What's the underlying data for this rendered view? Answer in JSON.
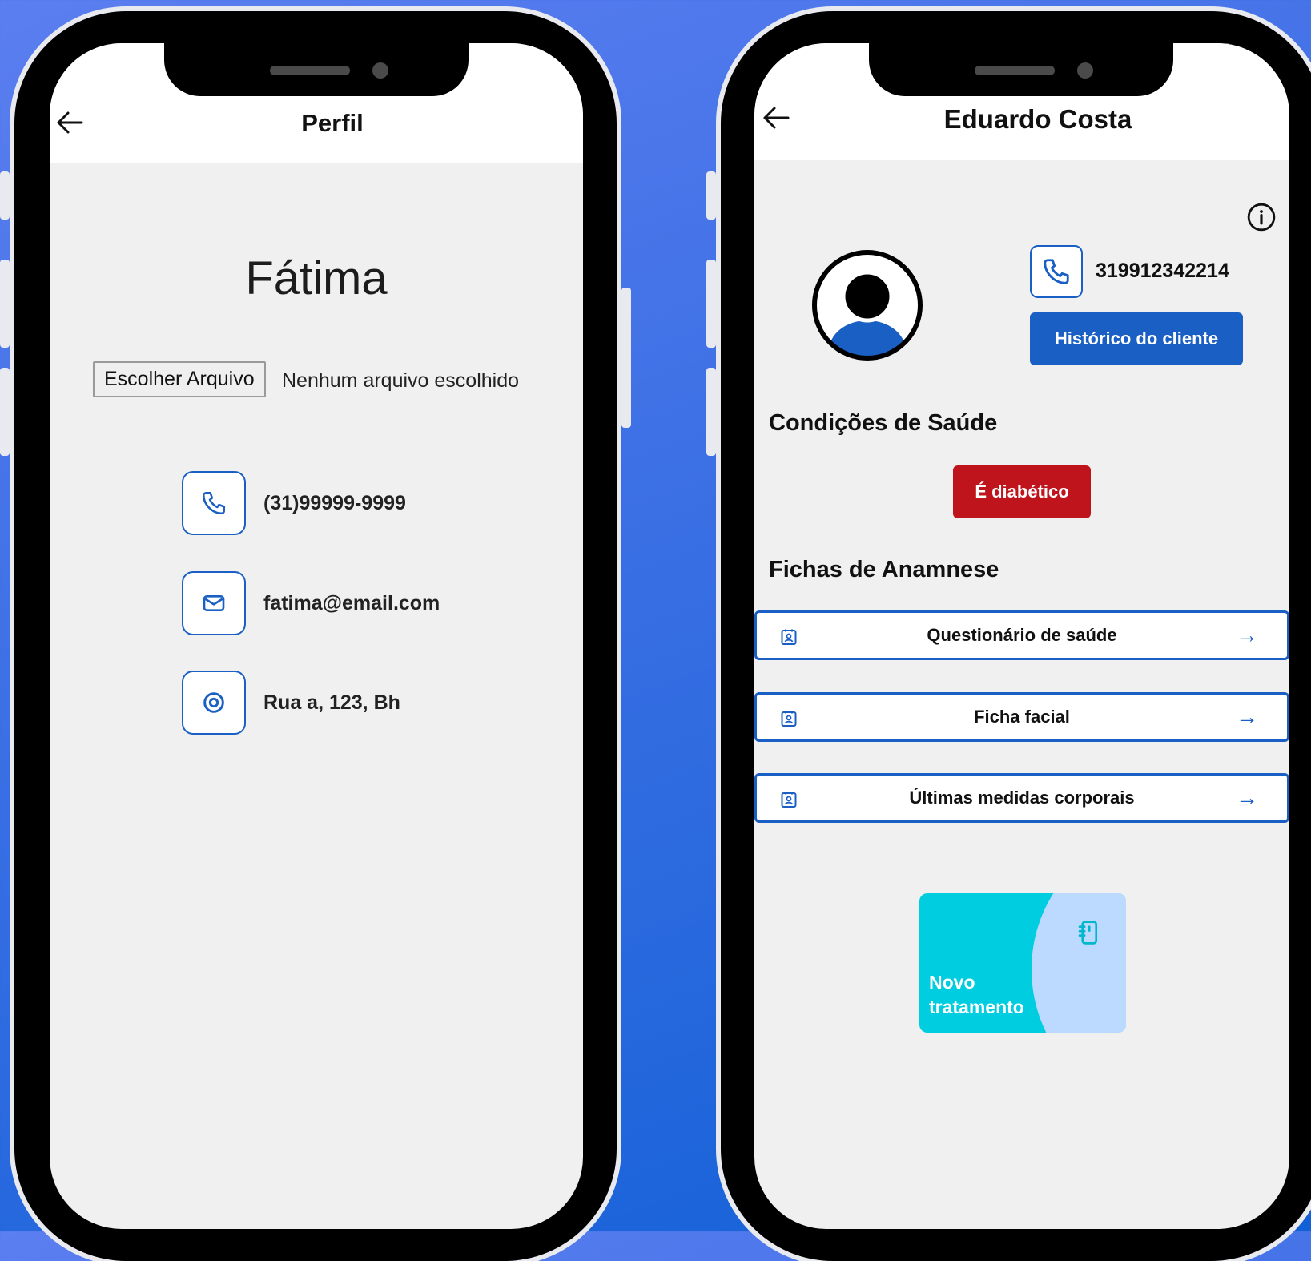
{
  "colors": {
    "background_start": "#5b7ef0",
    "background_end": "#1260d6",
    "primary_blue": "#1a5fc4",
    "danger_red": "#c0141c",
    "card_cyan": "#00cde0",
    "card_light_blue": "#bcd9ff"
  },
  "profile_screen": {
    "title": "Perfil",
    "back_icon": "arrow-left-icon",
    "name": "Fátima",
    "file_button_label": "Escolher Arquivo",
    "file_status": "Nenhum arquivo escolhido",
    "contacts": [
      {
        "icon": "phone-icon",
        "value": "(31)99999-9999"
      },
      {
        "icon": "mail-icon",
        "value": "fatima@email.com"
      },
      {
        "icon": "location-pin-icon",
        "value": "Rua a, 123, Bh"
      }
    ]
  },
  "client_screen": {
    "title": "Eduardo Costa",
    "back_icon": "arrow-left-icon",
    "info_icon": "info-icon",
    "avatar_icon": "user-avatar-icon",
    "phone_icon": "phone-icon",
    "phone_number": "319912342214",
    "history_button_label": "Histórico do cliente",
    "health_section_title": "Condições de Saúde",
    "conditions": [
      "É diabético"
    ],
    "anamnesis_section_title": "Fichas de Anamnese",
    "forms": [
      {
        "icon": "contact-card-icon",
        "label": "Questionário de saúde",
        "arrow": "→"
      },
      {
        "icon": "contact-card-icon",
        "label": "Ficha facial",
        "arrow": "→"
      },
      {
        "icon": "contact-card-icon",
        "label": "Últimas medidas corporais",
        "arrow": "→"
      }
    ],
    "new_treatment": {
      "icon": "notebook-icon",
      "line1": "Novo",
      "line2": "tratamento"
    }
  }
}
